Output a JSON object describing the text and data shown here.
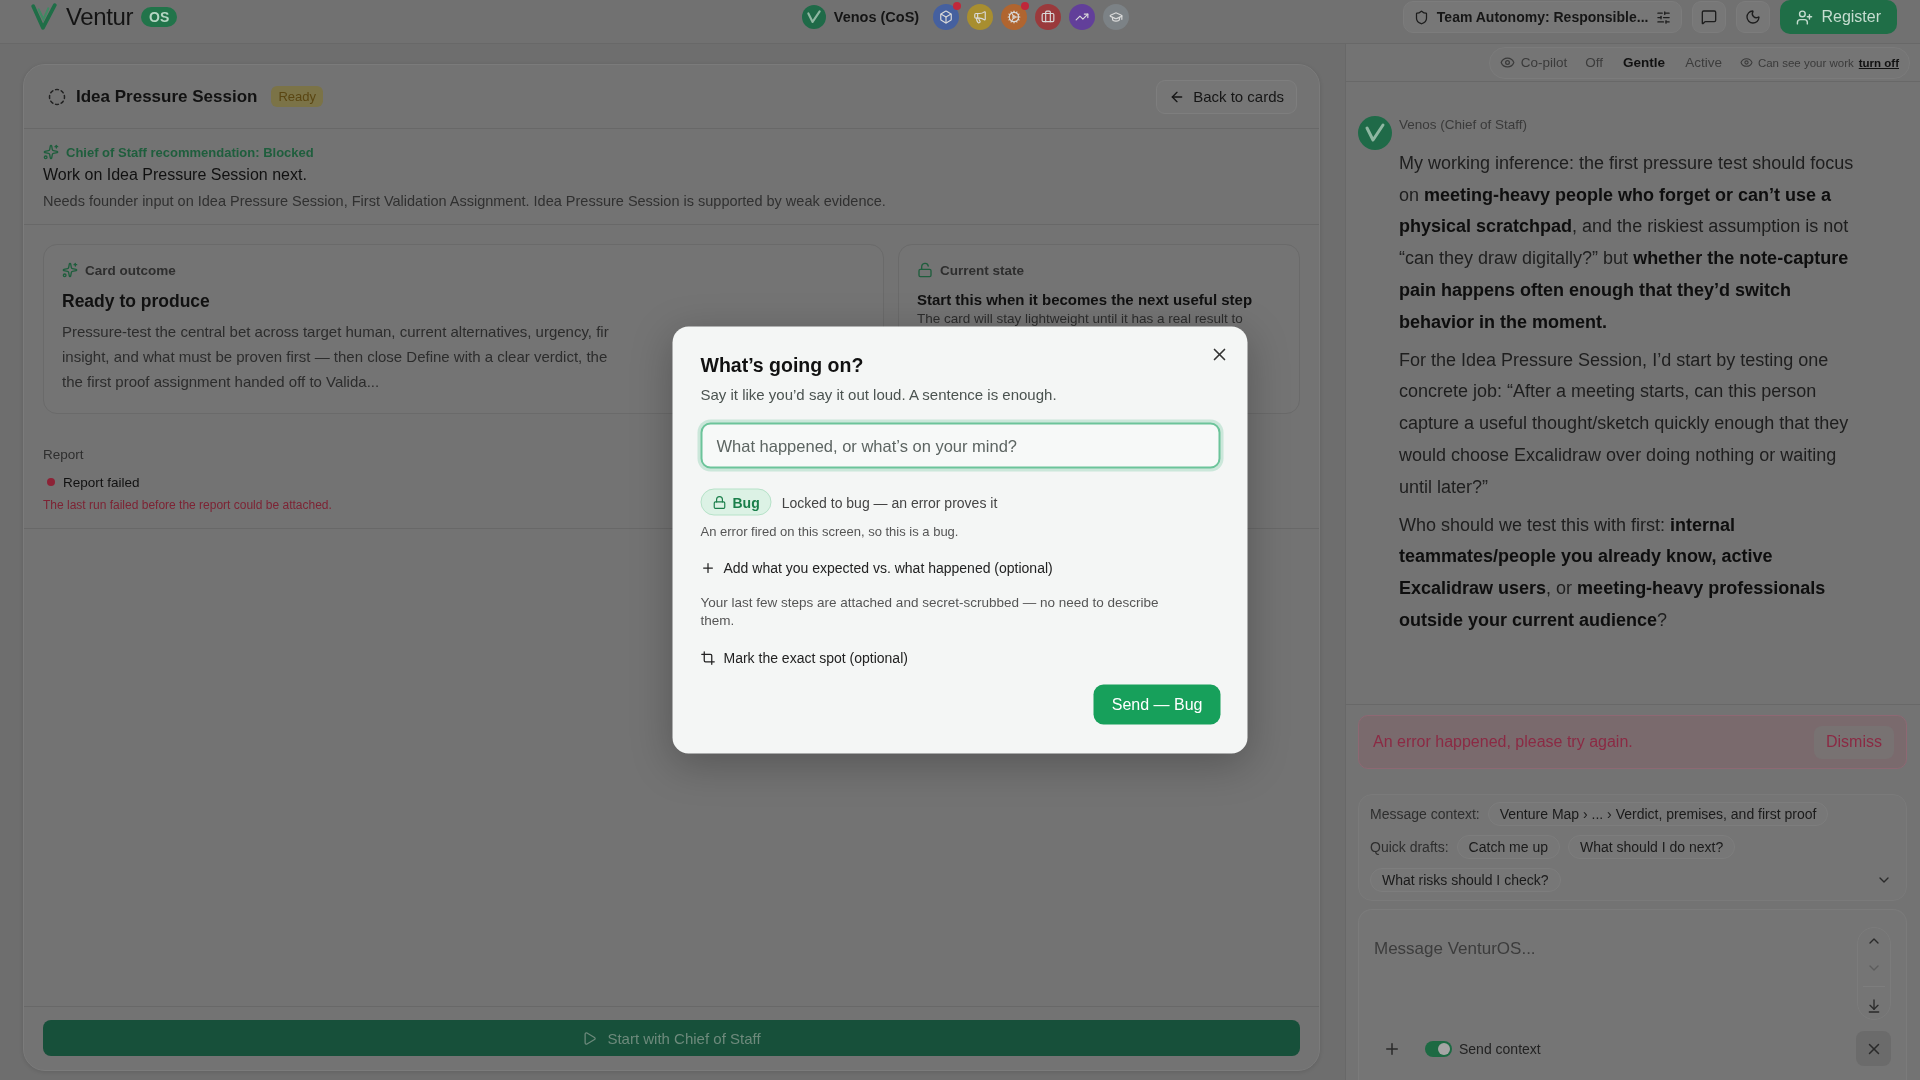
{
  "top_bar": {
    "brand": "Ventur",
    "brand_badge": "OS",
    "active_agent": "Venos (CoS)",
    "agents": [
      {
        "color": "#45609f",
        "notification": true
      },
      {
        "color": "#a88e2f",
        "notification": false
      },
      {
        "color": "#b06530",
        "notification": true
      },
      {
        "color": "#9a3a3c",
        "notification": false
      },
      {
        "color": "#623f9a",
        "notification": false
      },
      {
        "color": "#7c8286",
        "notification": false
      }
    ],
    "team_mode": "Team Autonomy: Responsible...",
    "register_button": "Register"
  },
  "card": {
    "title": "Idea Pressure Session",
    "status": "Ready",
    "back_button": "Back to cards",
    "recommendation": {
      "label": "Chief of Staff recommendation: Blocked",
      "headline": "Work on Idea Pressure Session next.",
      "detail": "Needs founder input on Idea Pressure Session, First Validation Assignment. Idea Pressure Session is supported by weak evidence."
    },
    "panels": [
      {
        "kind": "outcome",
        "label": "Card outcome",
        "title": "Ready to produce",
        "lines": [
          "Pressure-test the central bet across target human, current alternatives, urgency, fir",
          "insight, and what must be proven first — then close Define with a clear verdict, the",
          "the first proof assignment handed off to Valida..."
        ]
      },
      {
        "kind": "state",
        "label": "Current state",
        "title": "Start this when it becomes the next useful step",
        "lines": [
          "The card will stay lightweight until it has a real result to"
        ]
      }
    ],
    "report": {
      "label": "Report",
      "status": {
        "kind": "failed",
        "label": "Report failed"
      },
      "message": "The last run failed before the report could be attached."
    },
    "start_button": {
      "label": "Start with Chief of Staff",
      "disabled": true
    }
  },
  "assistant": {
    "copilot": {
      "label": "Co-pilot",
      "modes": [
        {
          "label": "Off",
          "selected": false
        },
        {
          "label": "Gentle",
          "selected": true
        },
        {
          "label": "Active",
          "selected": false
        }
      ],
      "visibility": "Can see your work",
      "visibility_link": "turn off"
    },
    "messages": [
      {
        "author": "Venos (Chief of Staff)",
        "paragraphs": [
          "My working inference: the first pressure test should focus on **meeting-heavy people who forget or can’t use a physical scratchpad**, and the riskiest assumption is not “can they draw digitally?” but **whether the note-capture pain happens often enough that they’d switch behavior in the moment.**",
          "For the Idea Pressure Session, I’d start by testing one concrete job: “After a meeting starts, can this person capture a useful thought/sketch quickly enough that they would choose Excalidraw over doing nothing or waiting until later?”",
          "Who should we test this with first: **internal teammates/people you already know, active Excalidraw users**, or **meeting-heavy professionals outside your current audience**?"
        ]
      }
    ],
    "error": {
      "message": "An error happened, please try again.",
      "dismiss_button": "Dismiss"
    },
    "context": {
      "label": "Message context:",
      "path": "Venture Map › ... › Verdict, premises, and first proof"
    },
    "quick_drafts": {
      "label": "Quick drafts:",
      "items": [
        "Catch me up",
        "What should I do next?",
        "What risks should I check?"
      ],
      "expanded": false
    },
    "composer": {
      "placeholder": "Message VenturOS...",
      "history_nav": [
        {
          "disabled": false
        },
        {
          "disabled": true
        }
      ],
      "send_context": {
        "label": "Send context",
        "on": true
      }
    }
  },
  "dialog": {
    "title": "What’s going on?",
    "subtitle": "Say it like you’d say it out loud. A sentence is enough.",
    "input": {
      "placeholder": "What happened, or what’s on your mind?"
    },
    "category": {
      "label": "Bug",
      "locked": true
    },
    "category_note": "Locked to bug — an error proves it",
    "reason": "An error fired on this screen, so this is a bug.",
    "add_details": "Add what you expected vs. what happened (optional)",
    "attachment_note": "Your last few steps are attached and secret-scrubbed — no need to describe them.",
    "mark_spot": "Mark the exact spot (optional)",
    "send_button": "Send — Bug"
  }
}
